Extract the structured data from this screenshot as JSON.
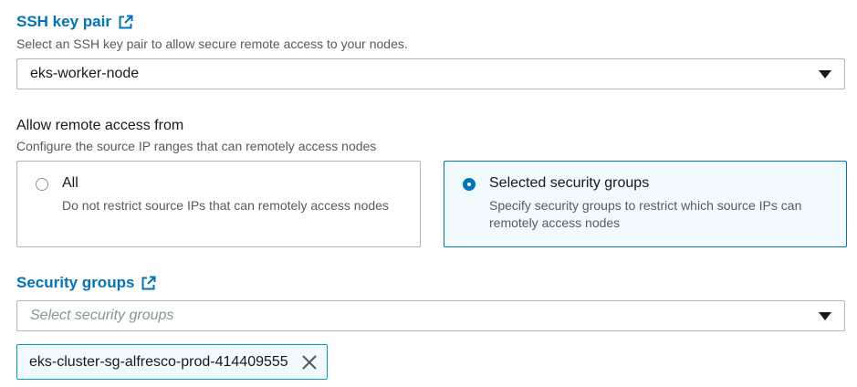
{
  "ssh": {
    "label": "SSH key pair",
    "description": "Select an SSH key pair to allow secure remote access to your nodes.",
    "selected": "eks-worker-node"
  },
  "remote_access": {
    "title": "Allow remote access from",
    "description": "Configure the source IP ranges that can remotely access nodes",
    "options": [
      {
        "label": "All",
        "description": "Do not restrict source IPs that can remotely access nodes",
        "selected": false
      },
      {
        "label": "Selected security groups",
        "description": "Specify security groups to restrict which source IPs can remotely access nodes",
        "selected": true
      }
    ]
  },
  "security_groups": {
    "label": "Security groups",
    "placeholder": "Select security groups",
    "tokens": [
      "eks-cluster-sg-alfresco-prod-414409555"
    ]
  },
  "colors": {
    "link": "#0073bb",
    "selected_border": "#0073bb",
    "selected_bg": "#f1faff",
    "token_border": "#00a1c9"
  },
  "icons": {
    "external": "external-link-icon",
    "caret": "caret-down-icon",
    "remove": "close-icon"
  }
}
